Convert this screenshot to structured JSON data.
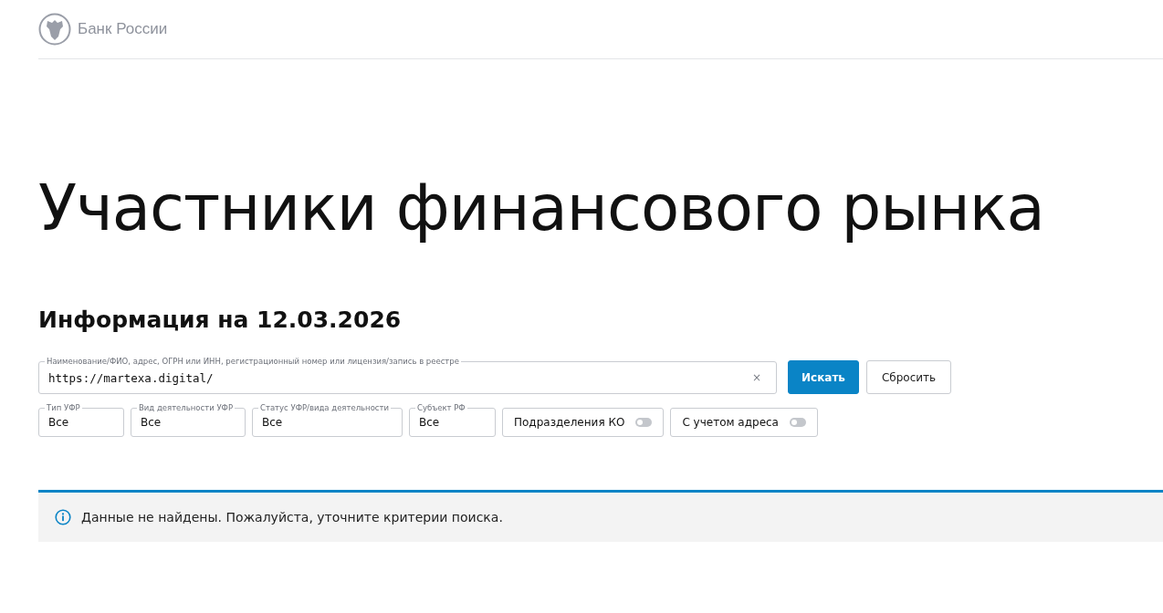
{
  "header": {
    "logo_text": "Банк России"
  },
  "page_title": "Участники финансового рынка",
  "info_date": "Информация на 12.03.2026",
  "search": {
    "label": "Наименование/ФИО, адрес, ОГРН или ИНН, регистрационный номер или лицензия/запись в реестре",
    "value": "https://martexa.digital/",
    "clear": "×"
  },
  "buttons": [
    {
      "label": "Искать",
      "kind": "primary"
    },
    {
      "label": "Сбросить",
      "kind": "secondary"
    }
  ],
  "filters": [
    {
      "kind": "select",
      "label": "Тип УФР",
      "value": "Все"
    },
    {
      "kind": "select",
      "label": "Вид деятельности УФР",
      "value": "Все"
    },
    {
      "kind": "select",
      "label": "Статус УФР/вида деятельности",
      "value": "Все"
    },
    {
      "kind": "select",
      "label": "Субъект РФ",
      "value": "Все"
    },
    {
      "kind": "toggle",
      "label": "Подразделения КО",
      "on": false
    },
    {
      "kind": "toggle",
      "label": "С учетом адреса",
      "on": false
    }
  ],
  "message": "Данные не найдены. Пожалуйста, уточните критерии поиска."
}
